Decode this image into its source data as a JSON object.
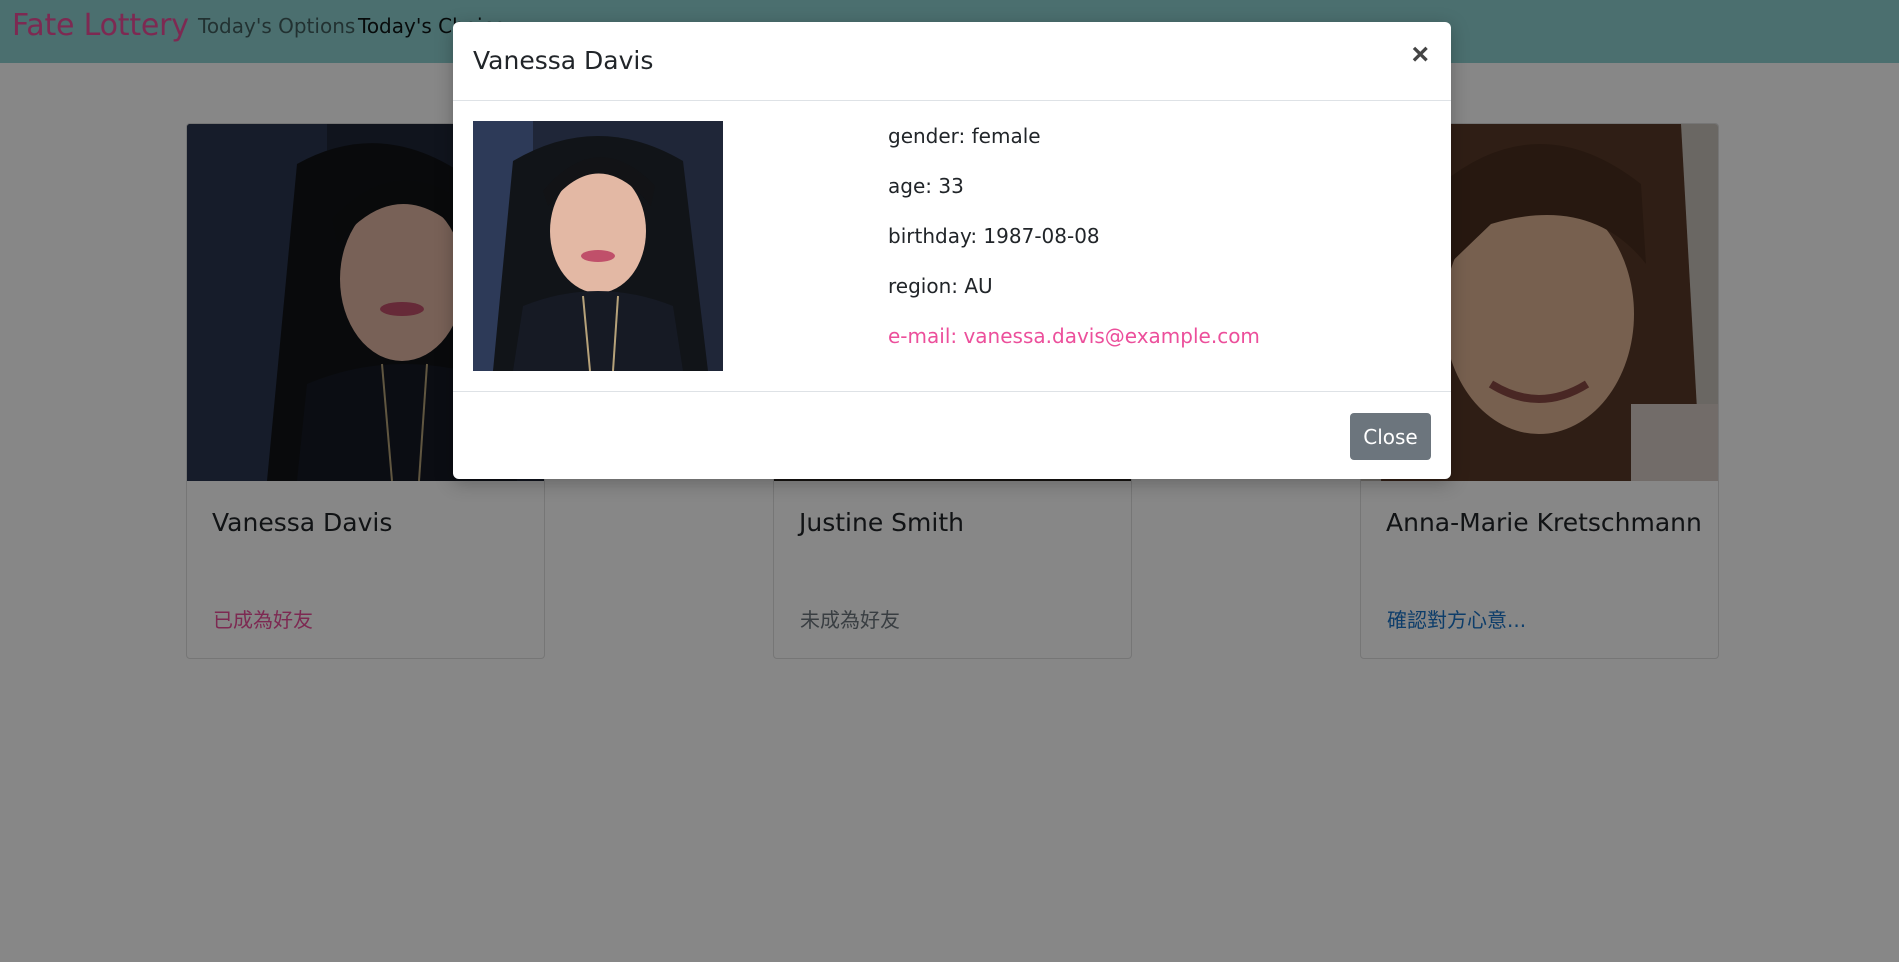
{
  "navbar": {
    "brand": "Fate Lottery",
    "links": [
      "Today's Options",
      "Today's Choice"
    ]
  },
  "cards": [
    {
      "name": "Vanessa Davis",
      "status": "已成為好友"
    },
    {
      "name": "Justine Smith",
      "status": "未成為好友"
    },
    {
      "name": "Anna-Marie Kretschmann",
      "status": "確認對方心意..."
    }
  ],
  "modal": {
    "title": "Vanessa Davis",
    "close_icon": "×",
    "gender": "gender: female",
    "age": "age: 33",
    "birthday": "birthday: 1987-08-08",
    "region": "region: AU",
    "email": "e-mail: vanessa.davis@example.com",
    "close_label": "Close"
  },
  "colors": {
    "navbar": "#8ed1d1",
    "brand": "#ec4f9b",
    "friend_status": "#ec4f9b",
    "confirm_status": "#1a73c8",
    "close_button": "#6c757d"
  }
}
